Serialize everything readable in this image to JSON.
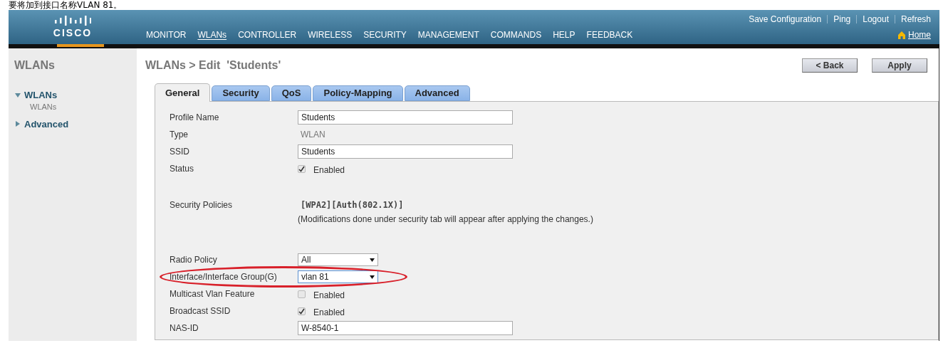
{
  "caption": "要将加到接口名称VLAN 81。",
  "header": {
    "logo": "CISCO",
    "top_links": [
      "Save Configuration",
      "Ping",
      "Logout",
      "Refresh"
    ],
    "menu": [
      {
        "label": "MONITOR",
        "selected": false
      },
      {
        "label": "WLANs",
        "selected": true
      },
      {
        "label": "CONTROLLER",
        "selected": false
      },
      {
        "label": "WIRELESS",
        "selected": false
      },
      {
        "label": "SECURITY",
        "selected": false
      },
      {
        "label": "MANAGEMENT",
        "selected": false
      },
      {
        "label": "COMMANDS",
        "selected": false
      },
      {
        "label": "HELP",
        "selected": false
      },
      {
        "label": "FEEDBACK",
        "selected": false
      }
    ],
    "home": "Home"
  },
  "sidebar": {
    "title": "WLANs",
    "items": [
      {
        "label": "WLANs",
        "expanded": true,
        "children": [
          {
            "label": "WLANs"
          }
        ]
      },
      {
        "label": "Advanced",
        "expanded": false
      }
    ]
  },
  "page": {
    "title": "WLANs > Edit  'Students'",
    "buttons": [
      "< Back",
      "Apply"
    ],
    "tabs": [
      {
        "label": "General",
        "selected": true
      },
      {
        "label": "Security",
        "selected": false
      },
      {
        "label": "QoS",
        "selected": false
      },
      {
        "label": "Policy-Mapping",
        "selected": false
      },
      {
        "label": "Advanced",
        "selected": false
      }
    ],
    "fields": [
      {
        "kind": "input",
        "label": "Profile Name",
        "value": "Students"
      },
      {
        "kind": "static",
        "label": "Type",
        "value": "WLAN"
      },
      {
        "kind": "input",
        "label": "SSID",
        "value": "Students"
      },
      {
        "kind": "checkbox",
        "label": "Status",
        "checked": true,
        "text": "Enabled"
      },
      {
        "kind": "policies",
        "label": "Security Policies",
        "value": "[WPA2][Auth(802.1X)]",
        "note": "(Modifications done under security tab will appear after applying the changes.)"
      },
      {
        "kind": "select",
        "label": "Radio Policy",
        "value": "All",
        "highlighted": false
      },
      {
        "kind": "select",
        "label": "Interface/Interface Group(G)",
        "value": "vlan 81",
        "highlighted": true
      },
      {
        "kind": "checkbox",
        "label": "Multicast Vlan Feature",
        "checked": false,
        "text": "Enabled"
      },
      {
        "kind": "checkbox",
        "label": "Broadcast SSID",
        "checked": true,
        "text": "Enabled"
      },
      {
        "kind": "input",
        "label": "NAS-ID",
        "value": "W-8540-1"
      }
    ]
  }
}
